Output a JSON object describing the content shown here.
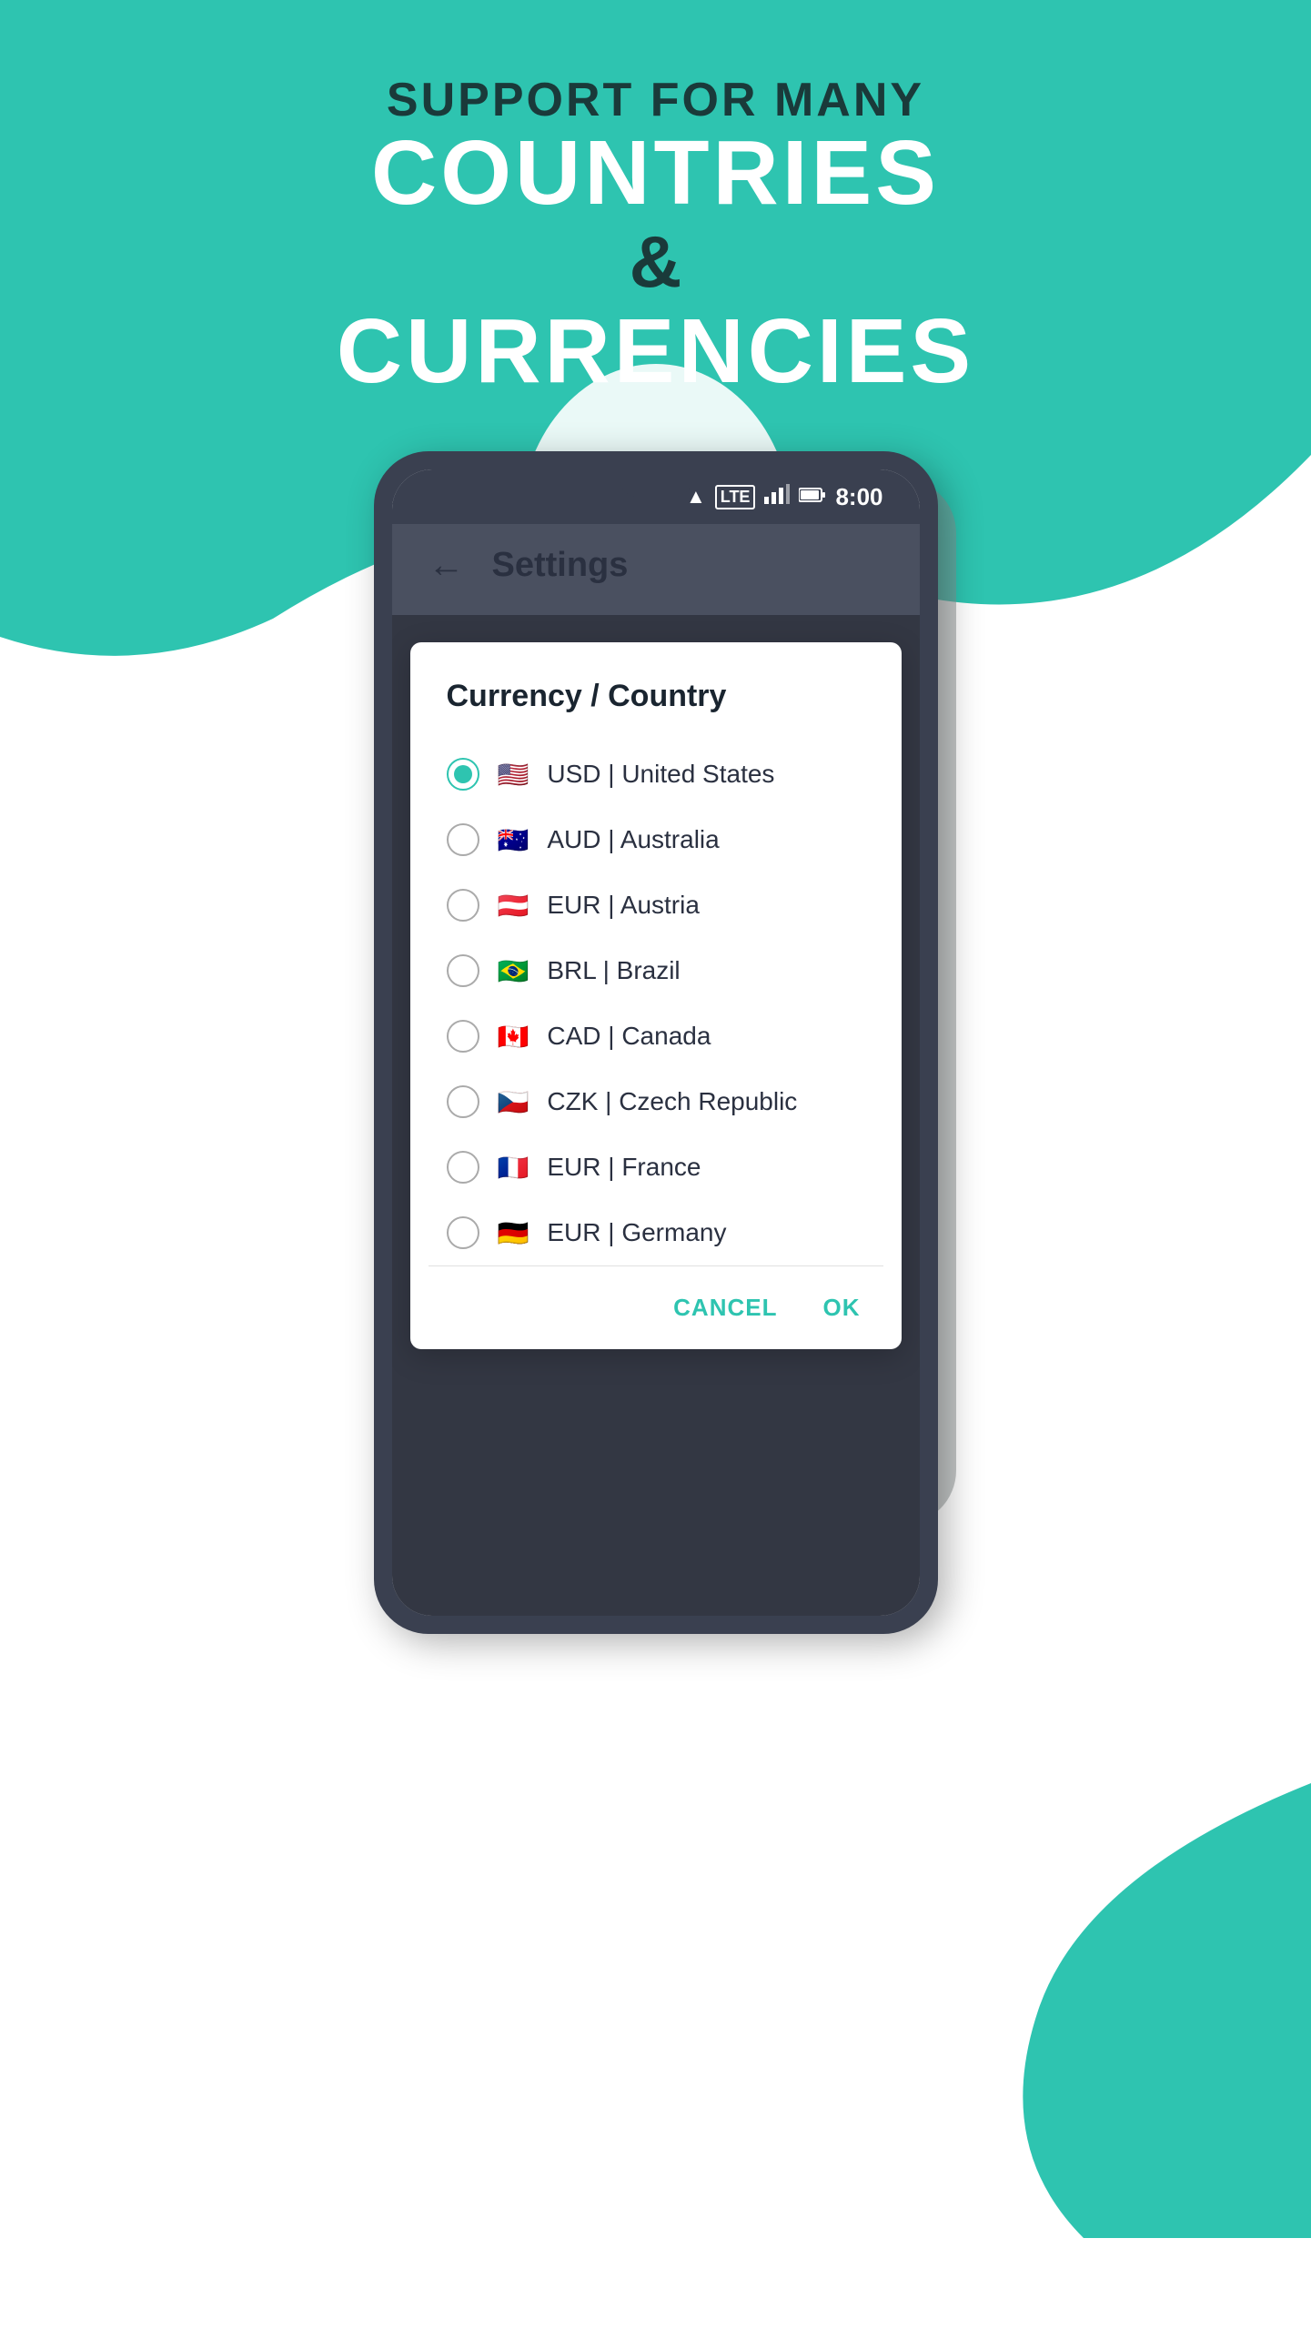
{
  "hero": {
    "subtitle": "SUPPORT FOR MANY",
    "title_line1": "COUNTRIES",
    "ampersand": "&",
    "title_line2": "CURRENCIES"
  },
  "status_bar": {
    "time": "8:00",
    "lte_label": "LTE"
  },
  "settings": {
    "back_label": "←",
    "title": "Settings"
  },
  "dialog": {
    "title": "Currency / Country",
    "options": [
      {
        "id": "usd",
        "selected": true,
        "currency": "USD",
        "country": "United States",
        "flag": "🇺🇸"
      },
      {
        "id": "aud",
        "selected": false,
        "currency": "AUD",
        "country": "Australia",
        "flag": "🇦🇺"
      },
      {
        "id": "eur_at",
        "selected": false,
        "currency": "EUR",
        "country": "Austria",
        "flag": "🇦🇹"
      },
      {
        "id": "brl",
        "selected": false,
        "currency": "BRL",
        "country": "Brazil",
        "flag": "🇧🇷"
      },
      {
        "id": "cad",
        "selected": false,
        "currency": "CAD",
        "country": "Canada",
        "flag": "🇨🇦"
      },
      {
        "id": "czk",
        "selected": false,
        "currency": "CZK",
        "country": "Czech Republic",
        "flag": "🇨🇿"
      },
      {
        "id": "eur_fr",
        "selected": false,
        "currency": "EUR",
        "country": "France",
        "flag": "🇫🇷"
      },
      {
        "id": "eur_de",
        "selected": false,
        "currency": "EUR",
        "country": "Germany",
        "flag": "🇩🇪"
      }
    ],
    "cancel_label": "CANCEL",
    "ok_label": "OK"
  },
  "colors": {
    "teal": "#2ec4b0",
    "dark": "#1a3a3a",
    "white": "#ffffff"
  }
}
